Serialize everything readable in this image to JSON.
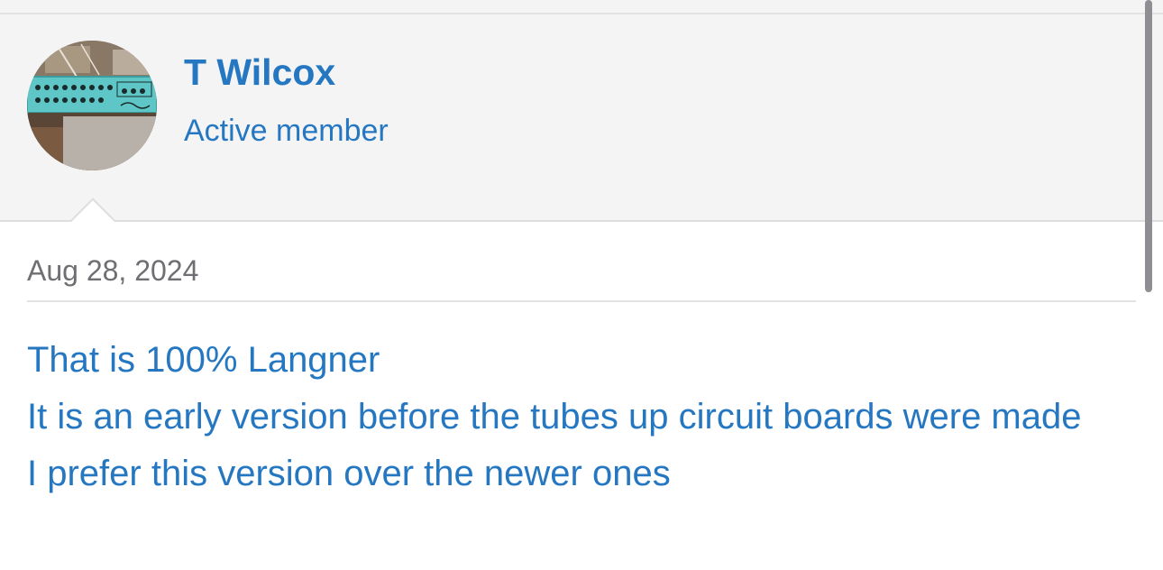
{
  "user": {
    "name": "T Wilcox",
    "title": "Active member",
    "avatar_icon": "user-avatar-amp-photo"
  },
  "post": {
    "date": "Aug 28, 2024",
    "lines": [
      "That is 100% Langner",
      "It is an early version before the tubes up circuit boards were made",
      "I prefer this version over the newer ones"
    ]
  },
  "colors": {
    "link": "#2577c1",
    "header_bg": "#f4f4f5",
    "date_text": "#6e6e73",
    "amp_panel": "#5cc4c4"
  }
}
